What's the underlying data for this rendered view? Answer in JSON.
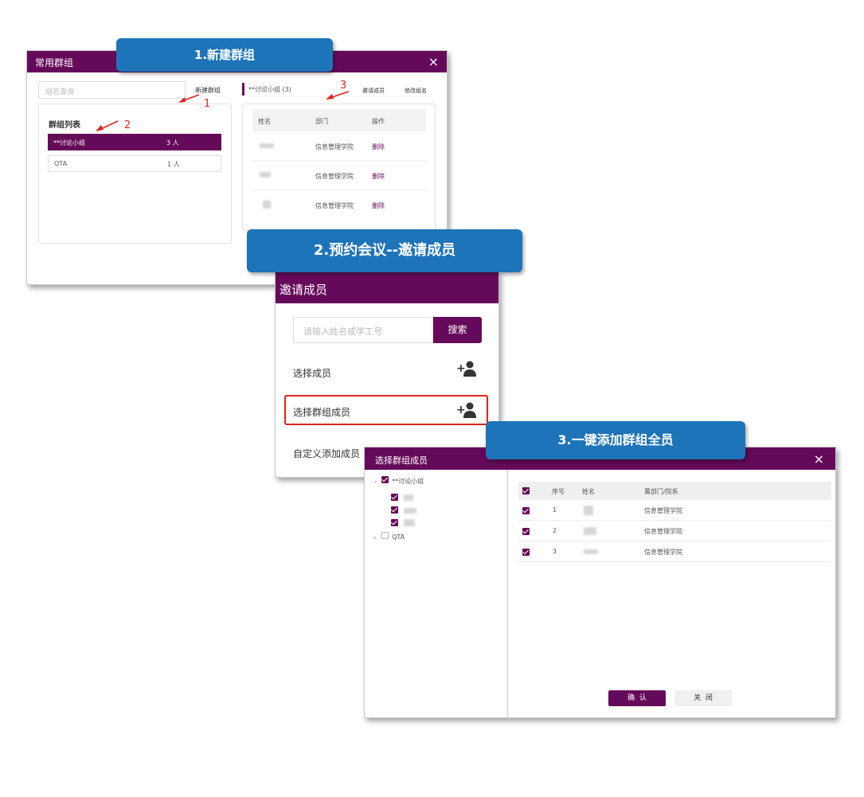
{
  "banners": {
    "step1": "1.新建群组",
    "step2": "2.预约会议--邀请成员",
    "step3": "3.一键添加群组全员"
  },
  "win1": {
    "title": "常用群组",
    "close": "×",
    "search_placeholder": "组名查询",
    "new_group": "新建群组",
    "group_list_title": "群组列表",
    "groups": [
      {
        "name": "**讨论小组",
        "count": "3 人"
      },
      {
        "name": "QTA",
        "count": "1 人"
      }
    ],
    "right_title": "**讨论小组 (3)",
    "invite": "邀请成员",
    "rename": "修改组名",
    "table_headers": [
      "姓名",
      "部门",
      "操作"
    ],
    "rows": [
      {
        "dept": "信息管理学院",
        "action": "删除"
      },
      {
        "dept": "信息管理学院",
        "action": "删除"
      },
      {
        "dept": "信息管理学院",
        "action": "删除"
      }
    ],
    "annot": {
      "one": "1",
      "two": "2",
      "three": "3"
    }
  },
  "win2": {
    "title": "邀请成员",
    "search_placeholder": "请输入姓名或学工号",
    "search_button": "搜索",
    "options": [
      "选择成员",
      "选择群组成员",
      "自定义添加成员"
    ]
  },
  "win3": {
    "title": "选择群组成员",
    "close": "×",
    "tree": {
      "group1": "**讨论小组",
      "group2": "QTA"
    },
    "table_headers": [
      "序号",
      "姓名",
      "属部门/院系"
    ],
    "rows": [
      {
        "no": "1",
        "dept": "信息管理学院"
      },
      {
        "no": "2",
        "dept": "信息管理学院"
      },
      {
        "no": "3",
        "dept": "信息管理学院"
      }
    ],
    "confirm": "确  认",
    "close_btn": "关  闭"
  }
}
